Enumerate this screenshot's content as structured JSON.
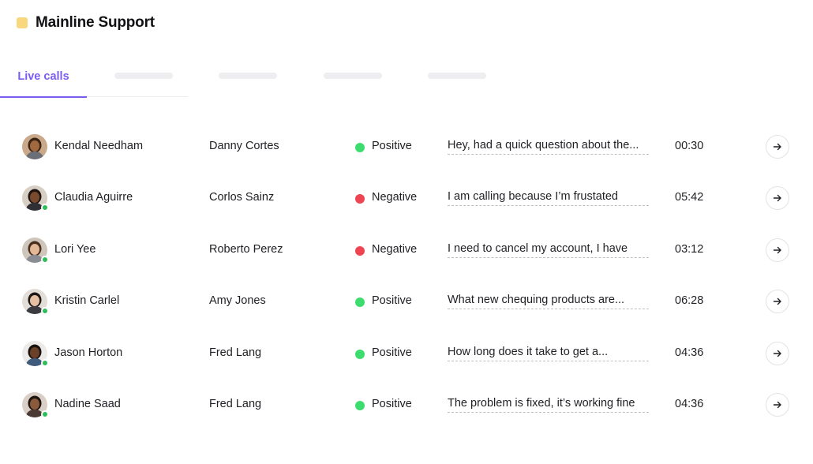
{
  "app": {
    "title": "Mainline Support",
    "logo_color": "#F8D77E"
  },
  "tabs": {
    "active_label": "Live calls",
    "accent_color": "#7B5CF0",
    "placeholder_count": 4
  },
  "colors": {
    "positive": "#3DDC6E",
    "negative": "#EF4452",
    "online": "#2EBD59"
  },
  "calls": [
    {
      "agent": "Kendal Needham",
      "customer": "Danny Cortes",
      "sentiment": "Positive",
      "transcript": "Hey, had a quick question about the...",
      "duration": "00:30",
      "online": false
    },
    {
      "agent": "Claudia Aguirre",
      "customer": "Corlos Sainz",
      "sentiment": "Negative",
      "transcript": "I am calling because I’m frustated",
      "duration": "05:42",
      "online": true
    },
    {
      "agent": "Lori Yee",
      "customer": "Roberto Perez",
      "sentiment": "Negative",
      "transcript": "I need to cancel my account, I have",
      "duration": "03:12",
      "online": true
    },
    {
      "agent": "Kristin Carlel",
      "customer": "Amy Jones",
      "sentiment": "Positive",
      "transcript": "What new chequing products are...",
      "duration": "06:28",
      "online": true
    },
    {
      "agent": "Jason Horton",
      "customer": "Fred Lang",
      "sentiment": "Positive",
      "transcript": "How long does it take to get a...",
      "duration": "04:36",
      "online": true
    },
    {
      "agent": "Nadine Saad",
      "customer": "Fred Lang",
      "sentiment": "Positive",
      "transcript": "The problem is fixed, it’s working fine",
      "duration": "04:36",
      "online": true
    }
  ],
  "icons": {
    "row_action": "arrow-right-icon",
    "avatar": "person-avatar",
    "logo": "square-logo-icon"
  }
}
